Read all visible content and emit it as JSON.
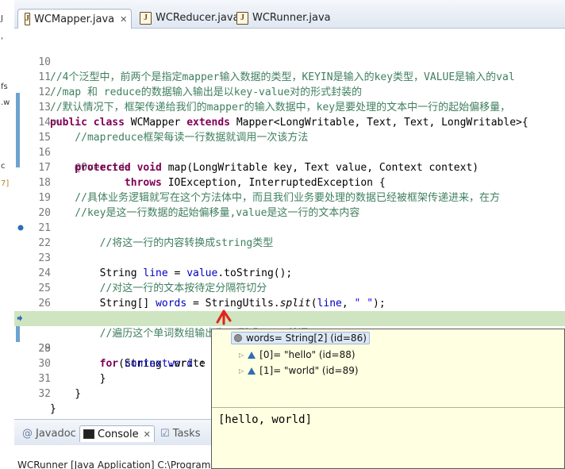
{
  "left_strip": {
    "fragments": [
      "J",
      "'",
      "fs",
      ".w",
      "c",
      "7]"
    ]
  },
  "editor_tabs": [
    {
      "label": "WCMapper.java",
      "active": true,
      "close": "✕"
    },
    {
      "label": "WCReducer.java",
      "active": false
    },
    {
      "label": "WCRunner.java",
      "active": false
    }
  ],
  "code": {
    "line_numbers": [
      "10",
      "11",
      "12",
      "13",
      "14",
      "15",
      "16",
      "17",
      "18",
      "19",
      "20",
      "21",
      "22",
      "23",
      "24",
      "25",
      "26",
      "27",
      "28",
      "29",
      "30",
      "31",
      "32"
    ],
    "l10": "//4个泛型中，前两个是指定mapper输入数据的类型，KEYIN是输入的key类型，VALUE是输入的val",
    "l11": "//map 和 reduce的数据输入输出是以key-value对的形式封装的",
    "l12": "//默认情况下，框架传递给我们的mapper的输入数据中，key是要处理的文本中一行的起始偏移量，",
    "l13_kw1": "public class",
    "l13_name": " WCMapper ",
    "l13_kw2": "extends",
    "l13_rest": " Mapper<LongWritable, Text, Text, LongWritable>{",
    "l14": "    //mapreduce框架每读一行数据就调用一次该方法",
    "l15": "    @Override",
    "l16_kw": "    protected void",
    "l16_rest1": " map(LongWritable ",
    "l16_key": "key",
    "l16_rest2": ", Text ",
    "l16_value": "value",
    "l16_rest3": ", Context ",
    "l16_ctx": "context",
    "l16_end": ")",
    "l17_kw": "            throws",
    "l17_rest": " IOException, InterruptedException {",
    "l18": "    //具体业务逻辑就写在这个方法体中，而且我们业务要处理的数据已经被框架传递进来，在方",
    "l19": "    //key是这一行数据的起始偏移量,value是这一行的文本内容",
    "l20": "",
    "l21": "        //将这一行的内容转换成string类型",
    "l22_a": "        String ",
    "l22_line": "line",
    "l22_b": " = ",
    "l22_value": "value",
    "l22_c": ".toString();",
    "l23": "",
    "l24": "        //对这一行的文本按待定分隔符切分",
    "l25_a": "        String[] ",
    "l25_words": "words",
    "l25_b": " = StringUtils.",
    "l25_split": "split",
    "l25_c": "(",
    "l25_line": "line",
    "l25_d": ", ",
    "l25_str": "\" \"",
    "l25_e": ");",
    "l26": "",
    "l27": "        //遍历这个单词数组输出为kv形式  K：单词   v：1",
    "l28_kw": "        for",
    "l28_a": "(String ",
    "l28_word": "word",
    "l28_b": " : ",
    "l28_words": "words",
    "l28_c": " ){",
    "l29_a": "            ",
    "l29_ctx": "context",
    "l29_b": ".write",
    "l30": "        }",
    "l31": "    }",
    "l32": "}"
  },
  "bottom_tabs": [
    {
      "label": "Javadoc",
      "active": false
    },
    {
      "label": "Console",
      "active": true,
      "close": "✕"
    },
    {
      "label": "Tasks",
      "active": false
    }
  ],
  "console_title": "WCRunner [Java Application] C:\\Program",
  "hover": {
    "root": "words= String[2]  (id=86)",
    "items": [
      "[0]= \"hello\" (id=88)",
      "[1]= \"world\" (id=89)"
    ],
    "detail": "[hello, world]"
  },
  "colors": {
    "comment": "#3f7f5f",
    "keyword": "#7f0055",
    "field": "#0000c0",
    "string": "#2a00ff",
    "current_line": "#cfe5c1"
  }
}
